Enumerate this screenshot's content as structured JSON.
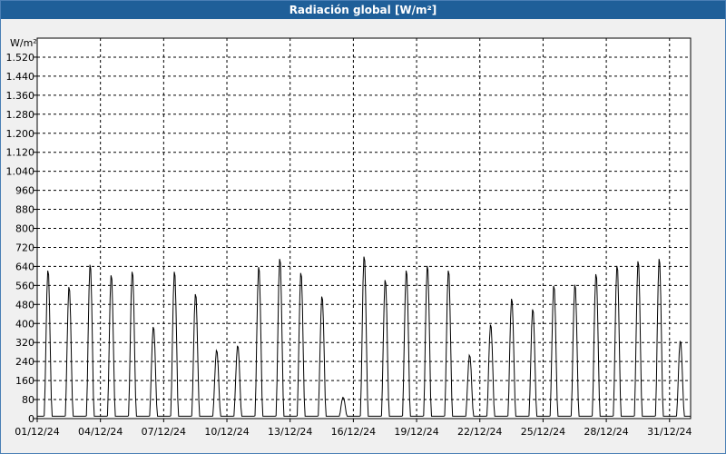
{
  "window": {
    "title": "Radiación global [W/m²]"
  },
  "chart_data": {
    "type": "line",
    "title": "Radiación global [W/m²]",
    "ylabel": "W/m²",
    "xlabel": "",
    "ylim": [
      0,
      1600
    ],
    "yticks": [
      0,
      80,
      160,
      240,
      320,
      400,
      480,
      560,
      640,
      720,
      800,
      880,
      960,
      1040,
      1120,
      1200,
      1280,
      1360,
      1440,
      1520
    ],
    "ytick_labels": [
      "0",
      "80",
      "160",
      "240",
      "320",
      "400",
      "480",
      "560",
      "640",
      "720",
      "800",
      "880",
      "960",
      "1.040",
      "1.120",
      "1.200",
      "1.280",
      "1.360",
      "1.440",
      "1.520"
    ],
    "x_start": "01/12/24",
    "x_end": "01/01/25",
    "xtick_labels": [
      "01/12/24",
      "04/12/24",
      "07/12/24",
      "10/12/24",
      "13/12/24",
      "16/12/24",
      "19/12/24",
      "22/12/24",
      "25/12/24",
      "28/12/24",
      "31/12/24"
    ],
    "grid": true,
    "series": [
      {
        "color": "#000000",
        "daily_peak_values": [
          630,
          560,
          655,
          610,
          625,
          390,
          625,
          530,
          290,
          310,
          645,
          680,
          620,
          520,
          90,
          690,
          590,
          630,
          650,
          630,
          270,
          400,
          510,
          465,
          565,
          570,
          615,
          650,
          670,
          680,
          330
        ]
      }
    ]
  }
}
